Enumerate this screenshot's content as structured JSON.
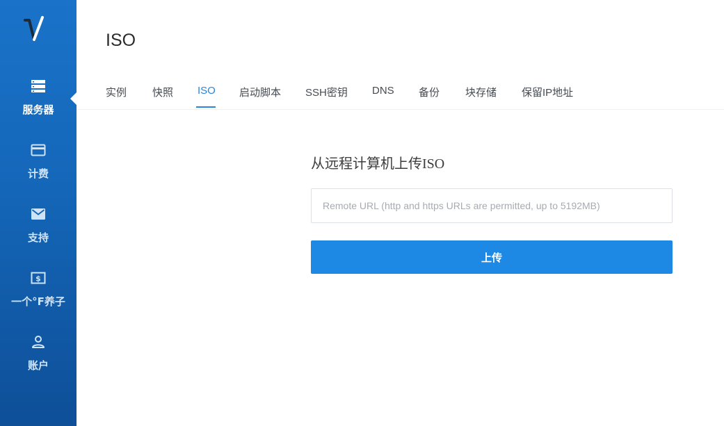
{
  "sidebar": {
    "items": [
      {
        "label": "服务器",
        "icon": "server-icon",
        "active": true
      },
      {
        "label": "计费",
        "icon": "credit-card-icon"
      },
      {
        "label": "支持",
        "icon": "envelope-icon"
      },
      {
        "label": "一个°F养子",
        "icon": "dollar-bill-icon"
      },
      {
        "label": "账户",
        "icon": "user-icon"
      }
    ]
  },
  "header": {
    "title": "ISO"
  },
  "tabs": [
    {
      "label": "实例"
    },
    {
      "label": "快照"
    },
    {
      "label": "ISO",
      "active": true
    },
    {
      "label": "启动脚本"
    },
    {
      "label": "SSH密钥"
    },
    {
      "label": "DNS"
    },
    {
      "label": "备份"
    },
    {
      "label": "块存储"
    },
    {
      "label": "保留IP地址"
    }
  ],
  "upload": {
    "heading": "从远程计算机上传ISO",
    "url_placeholder": "Remote URL (http and https URLs are permitted, up to 5192MB)",
    "url_value": "",
    "button_label": "上传"
  },
  "colors": {
    "accent": "#1e88e5",
    "sidebar": "#1466b8",
    "active_tab": "#2a86da"
  }
}
